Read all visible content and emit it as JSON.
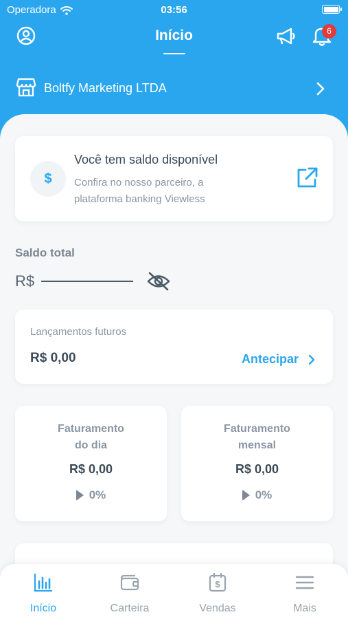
{
  "status_bar": {
    "carrier": "Operadora",
    "time": "03:56"
  },
  "header": {
    "title": "Início",
    "notification_count": "6"
  },
  "company": {
    "name": "Boltfy Marketing LTDA"
  },
  "balance_card": {
    "icon_glyph": "$",
    "heading": "Você tem saldo disponível",
    "description": "Confira no nosso parceiro, a plataforma banking Viewless"
  },
  "total": {
    "label": "Saldo total",
    "currency": "R$"
  },
  "future": {
    "label": "Lançamentos futuros",
    "value": "R$ 0,00",
    "action": "Antecipar"
  },
  "daily": {
    "title_line1": "Faturamento",
    "title_line2": "do dia",
    "value": "R$ 0,00",
    "percent": "0%"
  },
  "monthly": {
    "title_line1": "Faturamento",
    "title_line2": "mensal",
    "value": "R$ 0,00",
    "percent": "0%"
  },
  "tabs": [
    {
      "label": "Início",
      "icon": "bar-chart-icon",
      "active": true
    },
    {
      "label": "Carteira",
      "icon": "wallet-icon",
      "active": false
    },
    {
      "label": "Vendas",
      "icon": "calendar-dollar-icon",
      "active": false
    },
    {
      "label": "Mais",
      "icon": "menu-icon",
      "active": false
    }
  ],
  "colors": {
    "primary": "#2aa6ee",
    "badge": "#e23b3b",
    "background": "#f5f7f9"
  }
}
